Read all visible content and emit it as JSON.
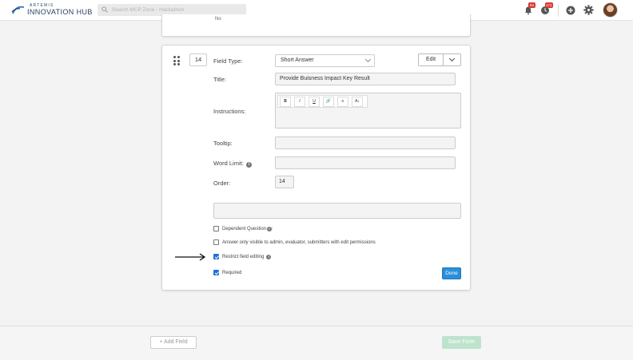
{
  "app": {
    "logo_small": "ARTEMIS",
    "logo_big": "INNOVATION HUB"
  },
  "topbar": {
    "search_placeholder": "Search MCP Zone - Hackathon",
    "notifications_count": "94",
    "activity_count": "171",
    "icons": [
      "bell-icon",
      "clock-icon",
      "plus-circle-icon",
      "gear-icon"
    ]
  },
  "prev_card": {
    "partial_text": "No"
  },
  "field": {
    "order_number": "14",
    "field_type_label": "Field Type:",
    "field_type_value": "Short Answer",
    "edit_label": "Edit",
    "title_label": "Title:",
    "title_value": "Provide Buisness Impact Key Result",
    "instructions_label": "Instructions:",
    "toolbar": [
      "B",
      "I",
      "U",
      "🔗",
      "≡",
      "A↕"
    ],
    "tooltip_label": "Tooltip:",
    "tooltip_value": "",
    "word_limit_label": "Word Limit:",
    "word_limit_value": "",
    "order_label": "Order:",
    "order_value": "14",
    "dependent_question_label": "Dependent Question",
    "dependent_question_suffix": ":",
    "answer_visibility_label": "Answer only visible to admin, evaluator, submitters with edit permissions",
    "restrict_editing_label": "Restrict field editing",
    "required_label": "Required",
    "done_label": "Done",
    "checkboxes": {
      "dependent_question": false,
      "answer_visibility": false,
      "restrict_editing": true,
      "required": true
    }
  },
  "footer": {
    "add_field_label": "+ Add Field",
    "save_form_label": "Save Form"
  },
  "colors": {
    "primary_blue": "#2b8fd8",
    "badge_red": "#d63b31",
    "save_disabled_green": "#bde3cd",
    "checkbox_blue": "#1f6fd6"
  }
}
